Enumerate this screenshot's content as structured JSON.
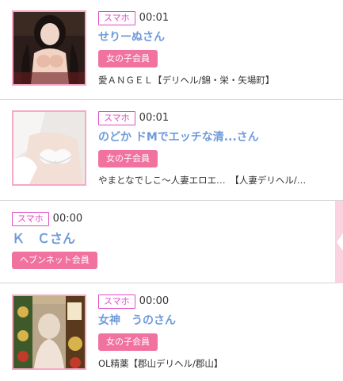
{
  "entries": [
    {
      "device": "スマホ",
      "time": "00:01",
      "name": "せりーぬさん",
      "member_type": "女の子会員",
      "shop": "愛ＡＮＧＥＬ【デリヘル/錦・栄・矢場町】"
    },
    {
      "device": "スマホ",
      "time": "00:01",
      "name": "のどか ドMでエッチな清...さん",
      "member_type": "女の子会員",
      "shop": "やまとなでしこ〜人妻エロエ…　【人妻デリヘル/…"
    },
    {
      "device": "スマホ",
      "time": "00:00",
      "name": "Ｋ　Ｃさん",
      "member_type": "ヘブンネット会員",
      "shop": ""
    },
    {
      "device": "スマホ",
      "time": "00:00",
      "name": "女神　うのさん",
      "member_type": "女の子会員",
      "shop": "OL精薬【郡山デリヘル/郡山】"
    }
  ],
  "colors": {
    "name": "#6f9bdc",
    "device_badge": "#e04cc6",
    "member_badge": "#f1729f",
    "thumb_border": "#f7a9c6"
  }
}
